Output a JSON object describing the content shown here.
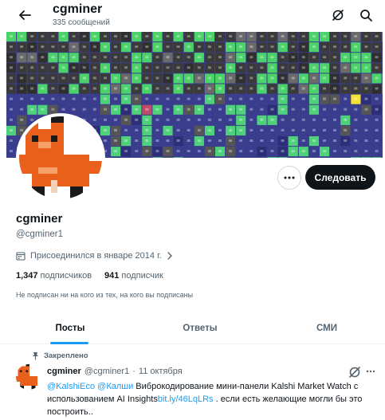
{
  "header": {
    "title": "cgminer",
    "subtitle": "335 сообщений",
    "back_icon": "arrow-left-icon",
    "grok_icon": "grok-icon",
    "search_icon": "search-icon"
  },
  "profile": {
    "name": "cgminer",
    "handle": "@cgminer1",
    "joined": "Присоединился в январе 2014 г.",
    "followers_count": "1,347",
    "followers_label": "подписчиков",
    "following_count": "941",
    "following_label": "подписчик",
    "follow_note": "Не подписан ни на кого из тех, на кого вы подписаны",
    "follow_button": "Следовать",
    "more_button_icon": "more-horizontal-icon"
  },
  "tabs": [
    {
      "label": "Посты",
      "active": true
    },
    {
      "label": "Ответы",
      "active": false
    },
    {
      "label": "СМИ",
      "active": false
    }
  ],
  "pinned_tweet": {
    "pinned_label": "Закреплено",
    "author_name": "cgminer",
    "author_handle": "@cgminer1",
    "separator": "·",
    "date": "11 октября",
    "mention1": "@KalshiEco",
    "mention2": "@Калши",
    "text1": "  Виброкодирование мини-панели Kalshi Market Watch с использованием AI Insights",
    "link": "bit.ly/46LqLRs",
    "text2": " . если есть желающие могли бы это построить.."
  },
  "colors": {
    "accent": "#1d9bf0",
    "follow_bg": "#0f1419",
    "muted": "#536471",
    "avatar_orange": "#e8601c"
  }
}
